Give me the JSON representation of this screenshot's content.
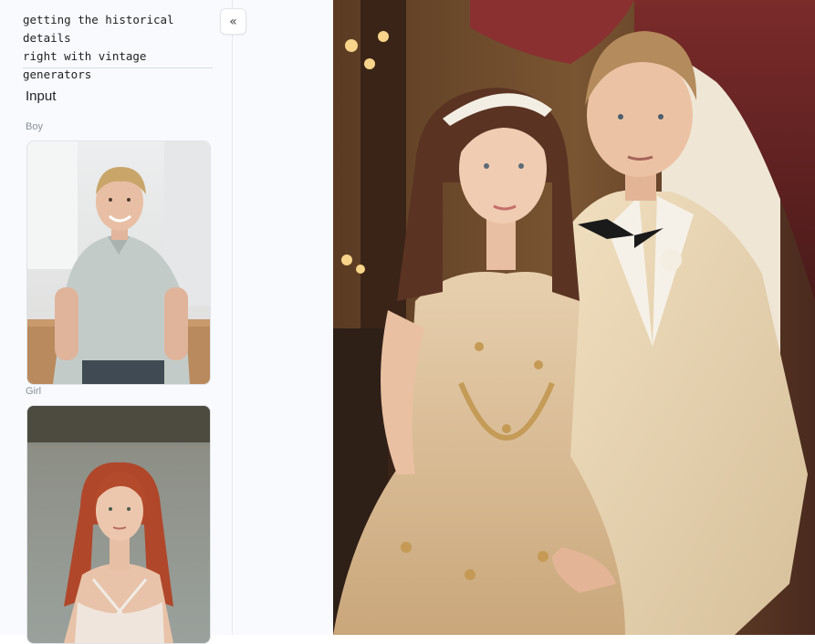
{
  "title": "getting the historical details\nright with vintage generators",
  "collapse_icon": "«",
  "input": {
    "heading": "Input",
    "images": [
      {
        "label": "Boy",
        "icon": "photo-boy"
      },
      {
        "label": "Girl",
        "icon": "photo-girl"
      }
    ]
  },
  "result": {
    "icon": "photo-couple-vintage-ballroom"
  },
  "colors": {
    "panel_bg": "#f8fafd",
    "divider": "#d9dde3"
  }
}
